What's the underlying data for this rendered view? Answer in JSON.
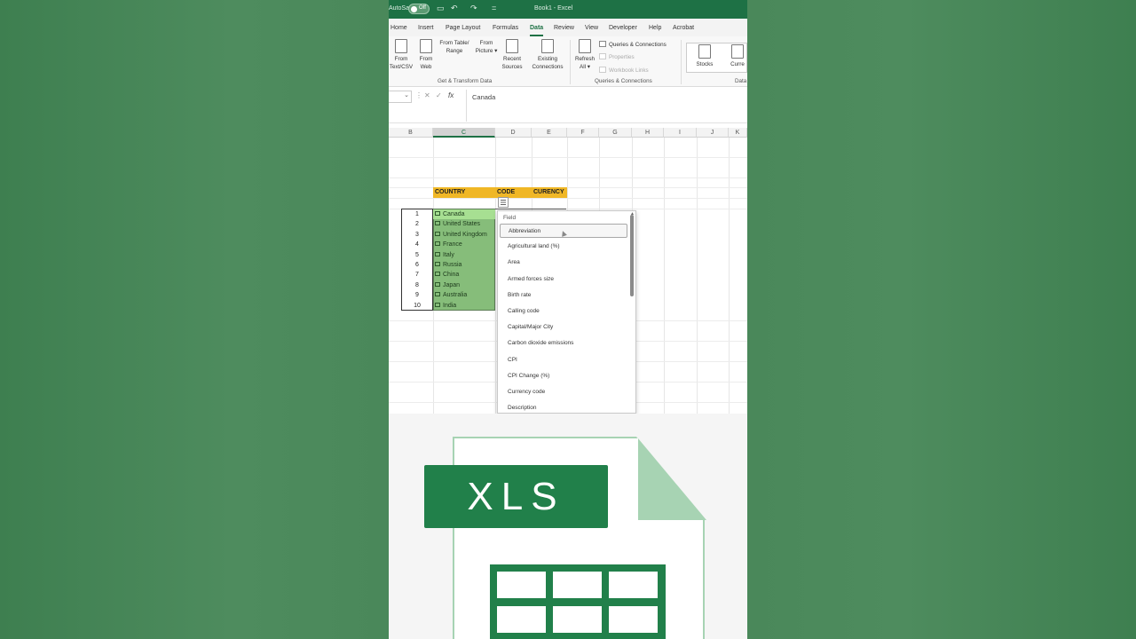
{
  "window": {
    "autosave_label": "AutoSave",
    "autosave_state": "Off",
    "title": "Book1 - Excel"
  },
  "ribbon": {
    "tabs": [
      "Home",
      "Insert",
      "Page Layout",
      "Formulas",
      "Data",
      "Review",
      "View",
      "Developer",
      "Help",
      "Acrobat"
    ],
    "active_tab": "Data",
    "get_transform": {
      "from_text": "From\nText/CSV",
      "from_web": "From\nWeb",
      "from_table": "From Table/\nRange",
      "from_picture": "From\nPicture ▾",
      "recent_sources": "Recent\nSources",
      "existing_connections": "Existing\nConnections",
      "group_label": "Get & Transform Data"
    },
    "queries": {
      "refresh_all": "Refresh\nAll ▾",
      "queries_connections": "Queries & Connections",
      "properties": "Properties",
      "workbook_links": "Workbook Links",
      "group_label": "Queries & Connections"
    },
    "data_types": {
      "stocks": "Stocks",
      "currencies": "Curre",
      "group_label": "Data"
    }
  },
  "formula_bar": {
    "name_box": "",
    "fx_label": "fx",
    "value": "Canada"
  },
  "sheet": {
    "columns": [
      "B",
      "C",
      "D",
      "E",
      "F",
      "G",
      "H",
      "I",
      "J",
      "K"
    ],
    "selected_column": "C",
    "headers": {
      "country": "COUNTRY",
      "code": "CODE",
      "currency": "CURENCY"
    },
    "row_numbers": [
      "1",
      "2",
      "3",
      "4",
      "5",
      "6",
      "7",
      "8",
      "9",
      "10"
    ],
    "countries": [
      "Canada",
      "United States",
      "United Kingdom",
      "France",
      "Italy",
      "Russia",
      "China",
      "Japan",
      "Australia",
      "India"
    ]
  },
  "field_dropdown": {
    "title": "Field",
    "items": [
      "Abbreviation",
      "Agricultural land (%)",
      "Area",
      "Armed forces size",
      "Birth rate",
      "Calling code",
      "Capital/Major City",
      "Carbon dioxide emissions",
      "CPI",
      "CPI Change (%)",
      "Currency code",
      "Description"
    ],
    "highlighted_index": 0
  },
  "illustration": {
    "badge_text": "XLS",
    "brand_color": "#21804a",
    "light_color": "#a7d3b3"
  }
}
